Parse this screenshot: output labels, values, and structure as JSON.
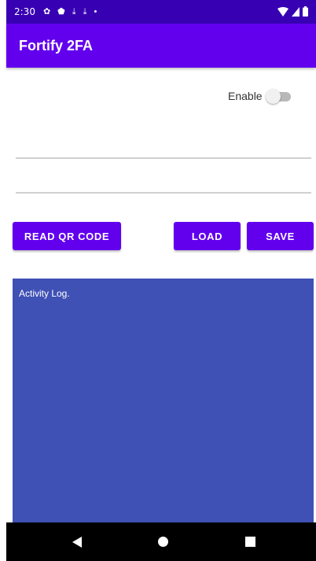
{
  "status_bar": {
    "time": "2:30",
    "icons": [
      "settings-icon",
      "shield-icon",
      "download-icon",
      "download-icon",
      "dot-icon"
    ],
    "right_icons": [
      "wifi-icon",
      "signal-icon",
      "battery-icon"
    ],
    "background": "#3700b3"
  },
  "app_bar": {
    "title": "Fortify 2FA",
    "background": "#6200ee"
  },
  "enable_toggle": {
    "label": "Enable",
    "checked": false
  },
  "fields": [
    {
      "value": "",
      "placeholder": ""
    },
    {
      "value": "",
      "placeholder": ""
    }
  ],
  "buttons": {
    "read_qr": "READ QR CODE",
    "load": "LOAD",
    "save": "SAVE",
    "color": "#6200ee"
  },
  "log": {
    "text": "Activity Log.",
    "background": "#3f51b5"
  },
  "nav_bar": {
    "icons": [
      "back-icon",
      "home-icon",
      "recents-icon"
    ]
  }
}
